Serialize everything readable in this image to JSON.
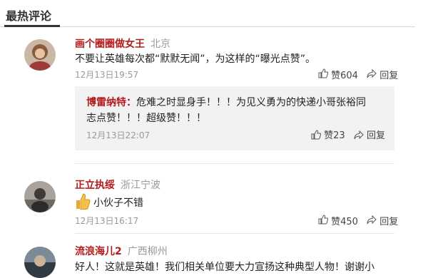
{
  "section": {
    "title": "最热评论"
  },
  "comments": [
    {
      "user": "画个圈圈做女王",
      "location": "北京",
      "text": "不要让英雄每次都“默默无闻”，为这样的“曝光点赞”。",
      "time": "12月13日19:57",
      "like_label": "赞604",
      "reply_label": "回复",
      "reply": {
        "user": "博雷纳特：",
        "line1": "危难之时显身手！！！为见义勇为的快递小哥张裕同",
        "line2": "志点赞！！！超级赞！！！",
        "time": "12月13日22:07",
        "like_label": "赞23",
        "reply_label": "回复"
      }
    },
    {
      "user": "正立执绥",
      "location": "浙江宁波",
      "text": "小伙子不错",
      "time": "12月13日16:17",
      "like_label": "赞450",
      "reply_label": "回复"
    },
    {
      "user": "流浪海儿2",
      "location": "广西柳州",
      "text": "好人！这就是英雄！我们相关单位要大力宣扬这种典型人物！谢谢小"
    }
  ],
  "icons": {
    "like": "thumbs-up-icon",
    "share": "share-arrow-icon",
    "emoji": "thumbs-up-emoji-icon"
  },
  "colors": {
    "username": "#b31b1b",
    "meta": "#999999",
    "reply_bg": "#f2f2f2"
  }
}
